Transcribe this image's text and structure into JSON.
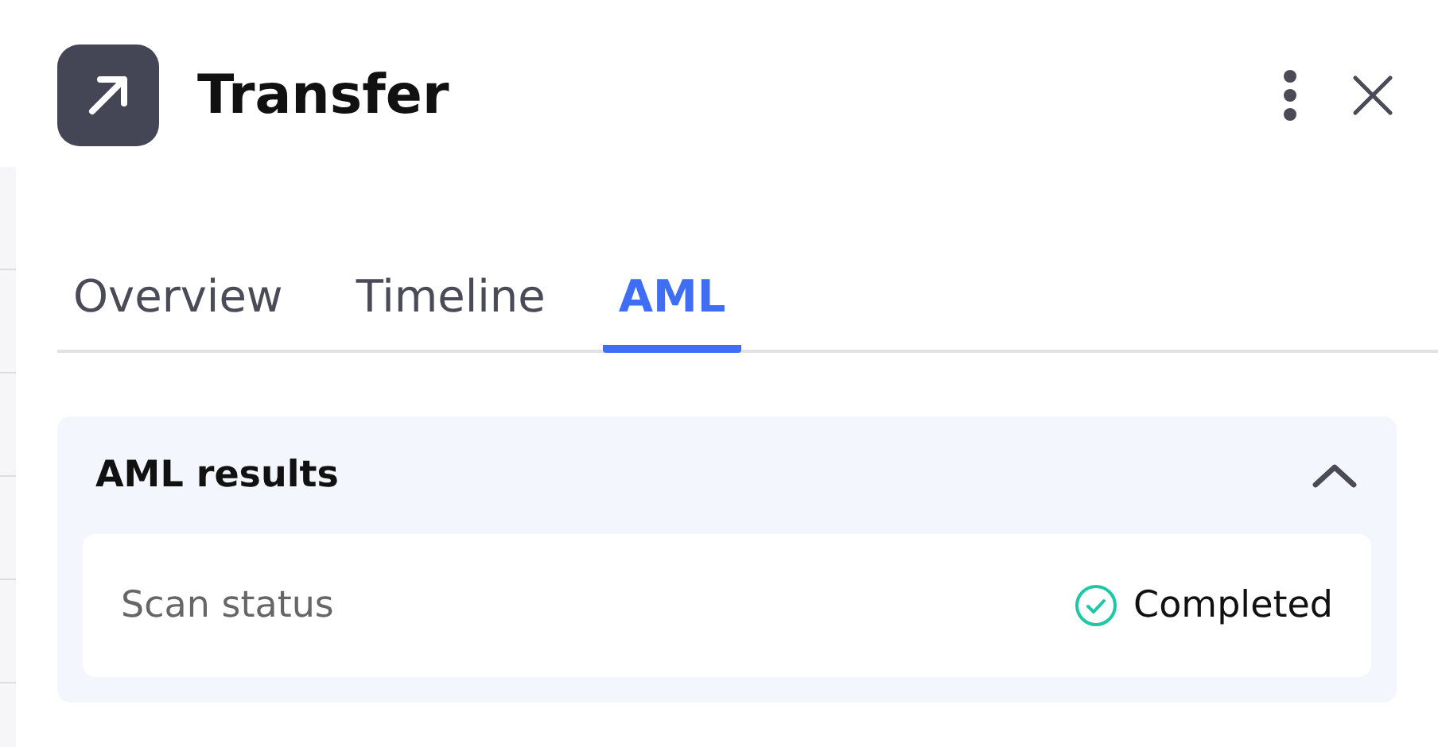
{
  "panel": {
    "title": "Transfer"
  },
  "tabs": [
    {
      "label": "Overview",
      "selected": false
    },
    {
      "label": "Timeline",
      "selected": false
    },
    {
      "label": "AML",
      "selected": true
    }
  ],
  "section": {
    "title": "AML results",
    "expanded": true,
    "rows": [
      {
        "label": "Scan status",
        "value": "Completed",
        "kind": "completed"
      }
    ]
  }
}
